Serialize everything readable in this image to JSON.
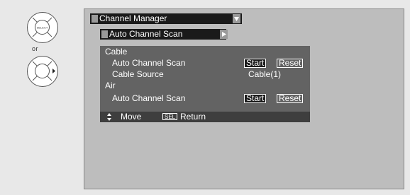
{
  "remote": {
    "select_button_label": "SELECT",
    "or_label": "or"
  },
  "menu": {
    "title": "Channel Manager",
    "submenu": "Auto Channel Scan"
  },
  "panel": {
    "cable_header": "Cable",
    "cable_scan_label": "Auto Channel Scan",
    "cable_start": "Start",
    "cable_reset": "Reset",
    "cable_source_label": "Cable Source",
    "cable_source_value": "Cable(1)",
    "air_header": "Air",
    "air_scan_label": "Auto Channel Scan",
    "air_start": "Start",
    "air_reset": "Reset"
  },
  "footer": {
    "move_label": "Move",
    "sel_key": "SEL",
    "return_label": "Return"
  },
  "colors": {
    "screen_bg": "#bdbdbd",
    "panel_bg": "#636363",
    "bar_bg": "#1a1a1a",
    "footer_bg": "#3e3e3e"
  }
}
